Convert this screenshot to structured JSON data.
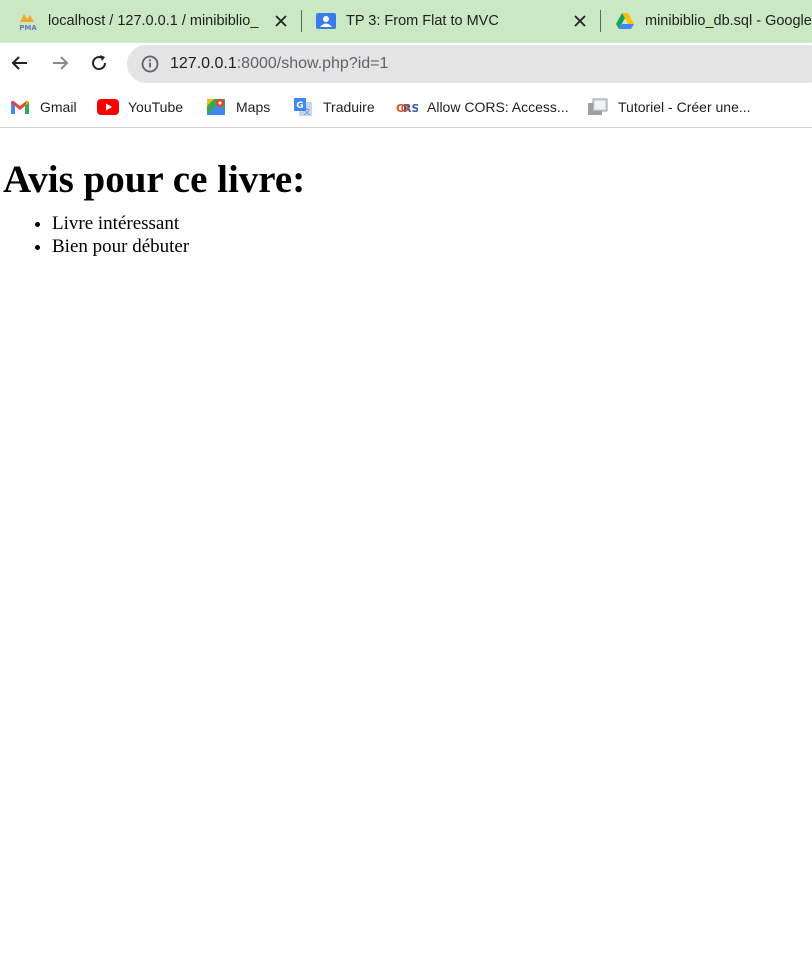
{
  "tabs": [
    {
      "title": "localhost / 127.0.0.1 / minibiblio_",
      "icon": "phpmyadmin-icon",
      "close": "×"
    },
    {
      "title": "TP 3: From Flat to MVC",
      "icon": "google-classroom-icon",
      "close": "×"
    },
    {
      "title": "minibiblio_db.sql - Google",
      "icon": "google-drive-icon"
    }
  ],
  "toolbar": {
    "url_host": "127.0.0.1",
    "url_rest": ":8000/show.php?id=1"
  },
  "bookmarks": [
    {
      "label": "Gmail",
      "icon": "gmail-icon"
    },
    {
      "label": "YouTube",
      "icon": "youtube-icon"
    },
    {
      "label": "Maps",
      "icon": "maps-icon"
    },
    {
      "label": "Traduire",
      "icon": "translate-icon"
    },
    {
      "label": "Allow CORS: Access...",
      "icon": "cors-icon"
    },
    {
      "label": "Tutoriel - Créer une...",
      "icon": "tutorial-icon"
    }
  ],
  "page": {
    "heading": "Avis pour ce livre:",
    "reviews": [
      "Livre intéressant",
      "Bien pour débuter"
    ]
  },
  "colors": {
    "tabstrip": "#cbe8c4",
    "omnibox": "#e4e4e4",
    "youtube_red": "#ff0000"
  }
}
